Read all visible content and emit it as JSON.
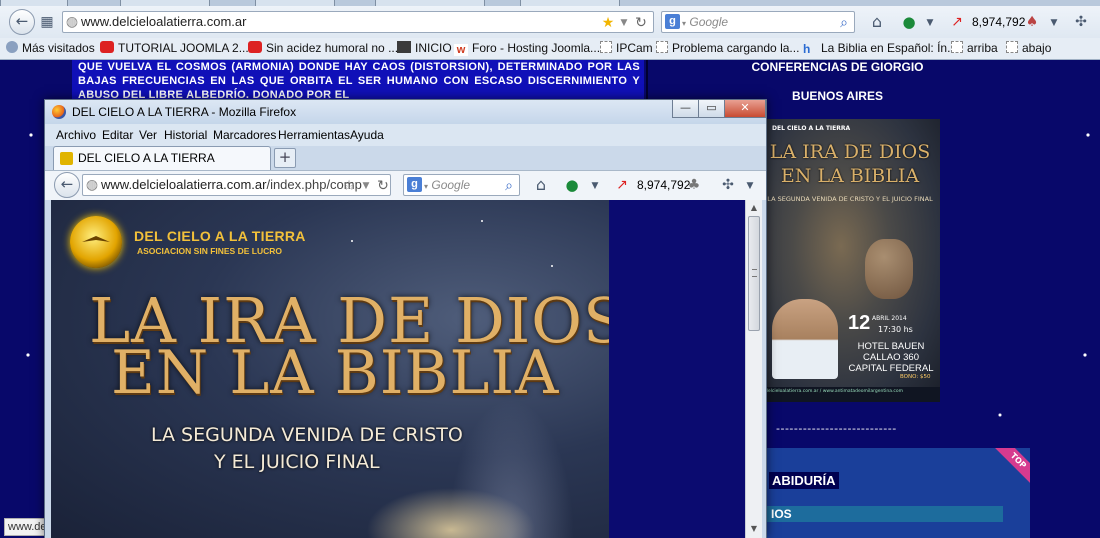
{
  "outer_browser": {
    "url_domain": "www.delcieloalatierra.com.ar",
    "search_placeholder": "Google",
    "counter": "8,974,792",
    "bookmarks": [
      {
        "label": "Más visitados",
        "icon": "gear-icon"
      },
      {
        "label": "TUTORIAL JOOMLA 2....",
        "icon": "youtube-icon"
      },
      {
        "label": "Sin acidez humoral no ...",
        "icon": "youtube-icon"
      },
      {
        "label": "INICIO",
        "icon": "joomla-icon"
      },
      {
        "label": "Foro - Hosting Joomla...",
        "icon": "w-icon"
      },
      {
        "label": "IPCam",
        "icon": "folder-icon"
      },
      {
        "label": "Problema cargando la...",
        "icon": "folder-icon"
      },
      {
        "label": "La Biblia en Español: Ín...",
        "icon": "h-icon"
      },
      {
        "label": "arriba",
        "icon": "folder-icon"
      },
      {
        "label": "abajo",
        "icon": "folder-icon"
      }
    ]
  },
  "background_page": {
    "left_text": "QUE VUELVA EL COSMOS (ARMONIA) DONDE HAY CAOS (DISTORSION), DETERMINADO POR LAS BAJAS FRECUENCIAS EN LAS QUE ORBITA EL SER HUMANO CON ESCASO DISCERNIMIENTO Y ABUSO DEL LIBRE ALBEDRÍO. DONADO POR EL",
    "right_title_1": "CONFERENCIAS DE GIORGIO",
    "right_title_2": "BUENOS AIRES",
    "poster": {
      "logo": "DEL CIELO A LA TIERRA",
      "title_1": "LA IRA DE DIOS",
      "title_2": "EN LA BIBLIA",
      "subtitle": "LA SEGUNDA VENIDA DE CRISTO Y EL JUICIO FINAL",
      "day": "12",
      "month": "ABRIL 2014",
      "time": "17:30 hs",
      "venue": "HOTEL BAUEN CALLAO 360 CAPITAL FEDERAL",
      "bono": "BONO: $50",
      "footer": "delcieloalatierra.com.ar / www.antimatadeomilargentina.com"
    },
    "dashes": "---------------------------",
    "top_ribbon": "TOP",
    "sabiduria": "ABIDURÍA",
    "ios_label": "IOS",
    "status_text": "www.del"
  },
  "fg_window": {
    "title": "DEL CIELO A LA TIERRA - Mozilla Firefox",
    "menu": [
      "Archivo",
      "Editar",
      "Ver",
      "Historial",
      "Marcadores",
      "Herramientas",
      "Ayuda"
    ],
    "tab_label": "DEL CIELO A LA TIERRA",
    "new_tab": "+",
    "url_domain": "www.delcieloalatierra.com.ar",
    "url_path": "/index.php/comp",
    "search_placeholder": "Google",
    "counter": "8,974,792",
    "buttons": {
      "minimize": "—",
      "maximize": "▭",
      "close": "✕"
    }
  },
  "hero": {
    "logo_name": "DEL CIELO A LA TIERRA",
    "logo_tag": "ASOCIACION SIN FINES DE LUCRO",
    "title_1": "LA IRA DE DIOS",
    "title_2": "EN LA BIBLIA",
    "subtitle_1": "LA SEGUNDA VENIDA DE CRISTO",
    "subtitle_2": "Y EL JUICIO FINAL"
  }
}
